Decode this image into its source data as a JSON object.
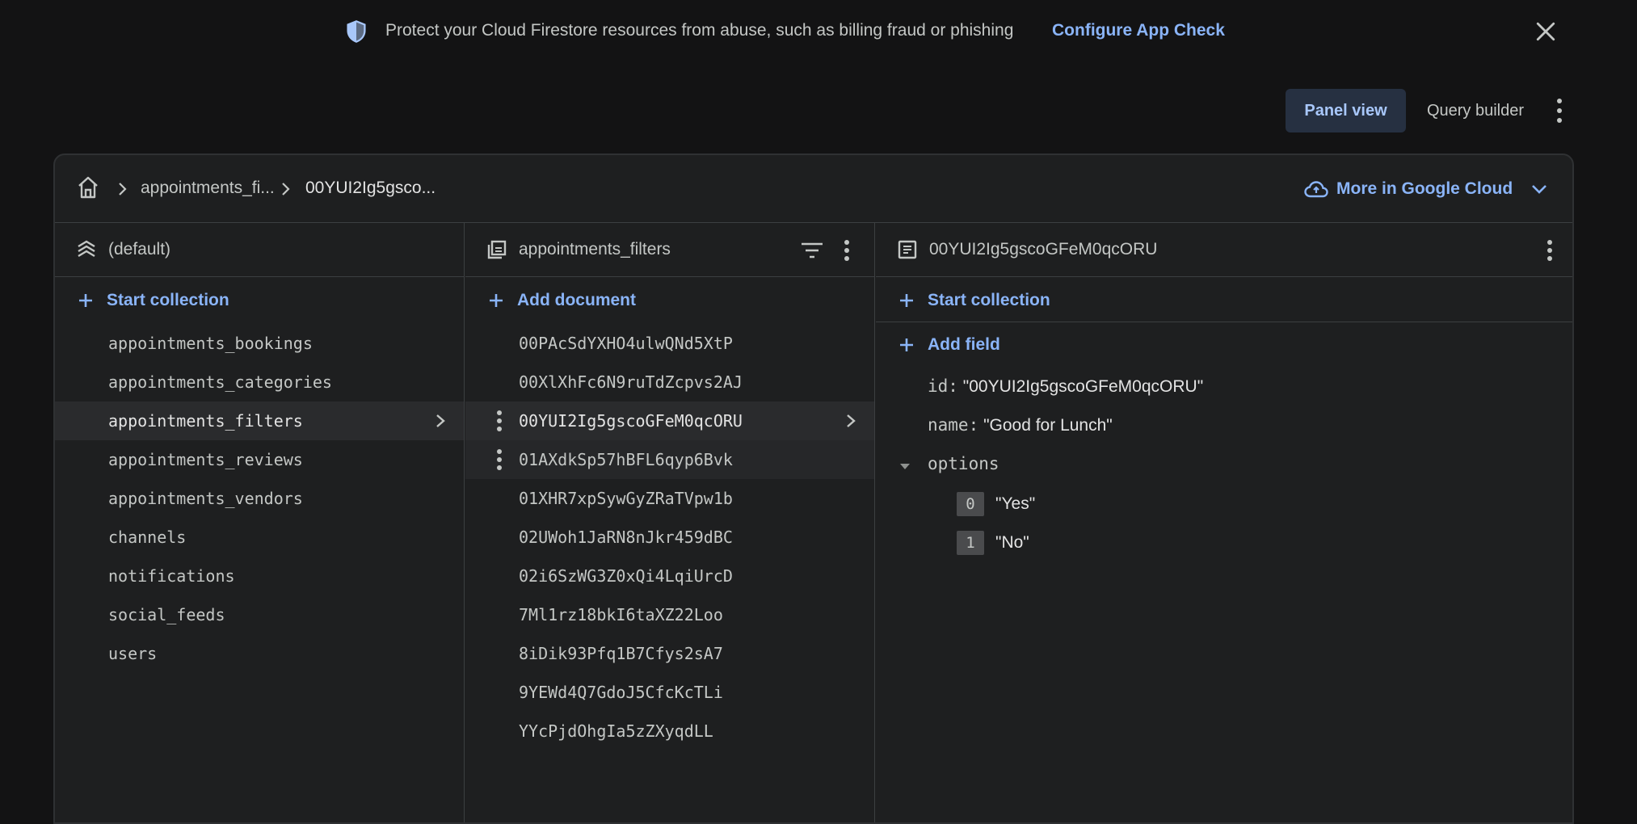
{
  "banner": {
    "message": "Protect your Cloud Firestore resources from abuse, such as billing fraud or phishing",
    "cta": "Configure App Check",
    "shield_icon": "shield-icon",
    "close_icon": "close-icon"
  },
  "view": {
    "panel_view": "Panel view",
    "query_builder": "Query builder"
  },
  "breadcrumb": {
    "items": [
      "appointments_fi...",
      "00YUI2Ig5gsco..."
    ]
  },
  "cloud": {
    "label": "More in Google Cloud"
  },
  "col1": {
    "title": "(default)",
    "add_label": "Start collection",
    "items": [
      "appointments_bookings",
      "appointments_categories",
      "appointments_filters",
      "appointments_reviews",
      "appointments_vendors",
      "channels",
      "notifications",
      "social_feeds",
      "users"
    ],
    "active_index": 2
  },
  "col2": {
    "title": "appointments_filters",
    "add_label": "Add document",
    "items": [
      "00PAcSdYXHO4ulwQNd5XtP",
      "00XlXhFc6N9ruTdZcpvs2AJ",
      "00YUI2Ig5gscoGFeM0qcORU",
      "01AXdkSp57hBFL6qyp6Bvk",
      "01XHR7xpSywGyZRaTVpw1b",
      "02UWoh1JaRN8nJkr459dBC",
      "02i6SzWG3Z0xQi4LqiUrcD",
      "7Ml1rz18bkI6taXZ22Loo",
      "8iDik93Pfq1B7Cfys2sA7",
      "9YEWd4Q7GdoJ5CfcKcTLi",
      "YYcPjdOhgIa5zZXyqdLL"
    ],
    "active_index": 2,
    "hover_index": 3
  },
  "col3": {
    "title": "00YUI2Ig5gscoGFeM0qcORU",
    "start_collection": "Start collection",
    "add_field": "Add field",
    "fields": {
      "id_key": "id:",
      "id_value": "\"00YUI2Ig5gscoGFeM0qcORU\"",
      "name_key": "name:",
      "name_value": "\"Good for Lunch\"",
      "options_key": "options",
      "options": [
        {
          "index": "0",
          "value": "\"Yes\""
        },
        {
          "index": "1",
          "value": "\"No\""
        }
      ]
    }
  },
  "colors": {
    "accent": "#8ab4f8",
    "background": "#131314",
    "panel": "#1e1f20"
  }
}
